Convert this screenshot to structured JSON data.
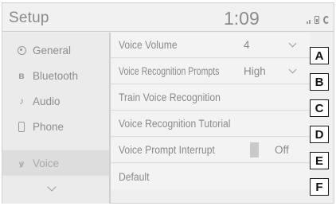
{
  "header": {
    "title": "Setup",
    "clock": "1:09",
    "status_icons": [
      "signal-icon",
      "battery-icon",
      "connection-icon"
    ]
  },
  "sidebar": {
    "items": [
      {
        "label": "General",
        "icon": "gear-icon"
      },
      {
        "label": "Bluetooth",
        "icon": "bluetooth-icon"
      },
      {
        "label": "Audio",
        "icon": "music-note-icon"
      },
      {
        "label": "Phone",
        "icon": "phone-icon"
      },
      {
        "label": "Voice",
        "icon": "voice-icon",
        "selected": true
      }
    ],
    "more_icon": "chevron-down-icon"
  },
  "main": {
    "rows": [
      {
        "label": "Voice Volume",
        "value": "4",
        "has_dropdown": true,
        "callout": "A"
      },
      {
        "label": "Voice Recognition Prompts",
        "value": "High",
        "has_dropdown": true,
        "callout": "B"
      },
      {
        "label": "Train Voice Recognition",
        "callout": "C"
      },
      {
        "label": "Voice Recognition Tutorial",
        "callout": "D"
      },
      {
        "label": "Voice Prompt Interrupt",
        "toggle_value": "Off",
        "callout": "E"
      },
      {
        "label": "Default",
        "callout": "F"
      }
    ]
  },
  "colors": {
    "screen_bg": "#efefef",
    "text": "#8a8a8a",
    "callout_border": "#1a1a1a"
  }
}
